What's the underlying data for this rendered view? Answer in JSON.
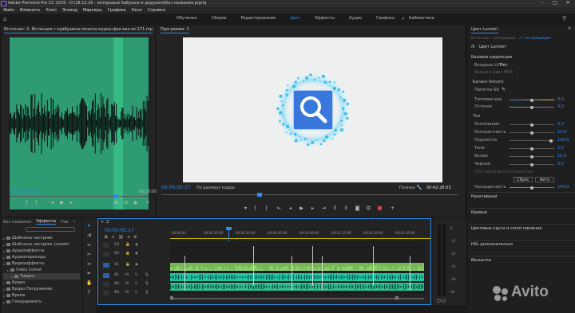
{
  "app": {
    "title": "Adobe Premiere Pro CC 2019 - D:\\28.12.20 - интерьвые бабушки и дедушки\\Без названия.prproj"
  },
  "menu": [
    "Файл",
    "Изменить",
    "Клип",
    "Эпизод",
    "Маркеры",
    "Графика",
    "Окно",
    "Справка"
  ],
  "workspaces": [
    {
      "label": "Обучение",
      "active": false
    },
    {
      "label": "Сборка",
      "active": false
    },
    {
      "label": "Редактирование",
      "active": false
    },
    {
      "label": "Цвет",
      "active": true
    },
    {
      "label": "Эффекты",
      "active": false
    },
    {
      "label": "Аудио",
      "active": false
    },
    {
      "label": "Графика",
      "active": false
    },
    {
      "label": "Библиотеки",
      "active": false
    }
  ],
  "source": {
    "tab": "Источник: 2- Истинция с крабушина мласка-мудка-фра-вах-ез-171.mp3: 00:42:12:41",
    "timecode": "00:00:30:32",
    "end_timecode": "00:00:00"
  },
  "program": {
    "tab": "Программа: 2",
    "timecode": "00:00:02:17",
    "fit": "По размеру кадра",
    "quality": "Полное",
    "duration": "00:42:28:03"
  },
  "lumetri": {
    "header": "Цвет Lumetri",
    "tab_master": "Источник * интерьвиде...",
    "tab_active": "2 * интервьюдвк",
    "fx_label": "fx",
    "fx_name": "Цвет Lumetri",
    "section_basic": "Базовая коррекция",
    "lut_label": "Входные LUT",
    "lut_value": "Нет",
    "hdr_label": "Белый в цвет HDR",
    "wb_section": "Баланс белого",
    "wb_picker": "Пипетка ББ",
    "temp_label": "Температура",
    "temp_value": "0,0",
    "tint_label": "Оттенок",
    "tint_value": "0,0",
    "tone_section": "Тон",
    "tone": [
      {
        "label": "Экспозиция",
        "value": "0,0"
      },
      {
        "label": "Контрастность",
        "value": "14,0"
      },
      {
        "label": "Подсветка",
        "value": "100,0"
      },
      {
        "label": "Тени",
        "value": "1,0"
      },
      {
        "label": "Белые",
        "value": "10,0"
      },
      {
        "label": "Черные",
        "value": "0,0"
      }
    ],
    "hdr_spec": "HDR зеркальное отражение",
    "reset": "Сброс",
    "auto": "Авто",
    "saturation_label": "Насыщенность",
    "saturation_value": "100,0",
    "sections": [
      "Креативный",
      "Кривые",
      "Цветовые круги и сопоставление",
      "HSL дополнительно",
      "Виньетка"
    ]
  },
  "project": {
    "tabs": [
      "Без названия",
      "Эффекты",
      "Тов"
    ],
    "items": [
      {
        "label": "Шаблоны настроек",
        "indent": 0
      },
      {
        "label": "Шаблоны настроек Lumetri",
        "indent": 0
      },
      {
        "label": "Аудиоэффекты",
        "indent": 0
      },
      {
        "label": "Аудиопереходы",
        "indent": 0
      },
      {
        "label": "Видеоэффекты",
        "indent": 0
      },
      {
        "label": "Video Comet",
        "indent": 1
      },
      {
        "label": "Тиерск",
        "indent": 2
      },
      {
        "label": "Видео",
        "indent": 0
      },
      {
        "label": "Видео Погружение",
        "indent": 0
      },
      {
        "label": "Время",
        "indent": 0
      },
      {
        "label": "Генерировать",
        "indent": 0
      }
    ]
  },
  "timeline": {
    "tab": "2",
    "timecode": "00:00:02:17",
    "ruler": [
      "00:00:00",
      "00:00:15:00",
      "00:00:30:00",
      "00:00:45:00",
      "00:01:00:00",
      "00:01:15:00",
      "00:01:30:00",
      "00:01:45:00"
    ],
    "video_tracks": [
      "V3",
      "V2",
      "V1"
    ],
    "audio_tracks": [
      "A1",
      "A2",
      "A3"
    ],
    "meter_labels": [
      "0",
      "-12",
      "-24",
      "-36",
      "-48",
      "dB"
    ]
  },
  "watermark": "Avito",
  "colors": {
    "accent": "#2d8ceb",
    "audio_green": "#2fbf8f",
    "video_green": "#8fd06a",
    "audio_teal": "#20c7a7",
    "playhead": "#2d8ceb"
  }
}
